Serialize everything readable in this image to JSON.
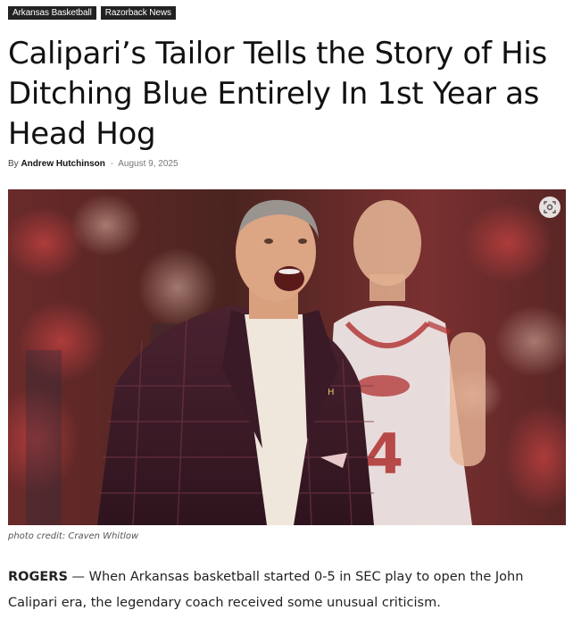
{
  "tags": [
    "Arkansas Basketball",
    "Razorback News"
  ],
  "headline": "Calipari’s Tailor Tells the Story of His Ditching Blue Entirely In 1st Year as Head Hog",
  "byline": {
    "prefix": "By",
    "author": "Andrew Hutchinson",
    "separator": "-",
    "date": "August 9, 2025"
  },
  "photo": {
    "jersey_number": "4",
    "lens_icon": "visual-search-icon"
  },
  "caption": "photo credit: Craven Whitlow",
  "article": {
    "lead": "ROGERS",
    "text": " — When Arkansas basketball started 0-5 in SEC play to open the John Calipari era, the legendary coach received some unusual criticism."
  }
}
